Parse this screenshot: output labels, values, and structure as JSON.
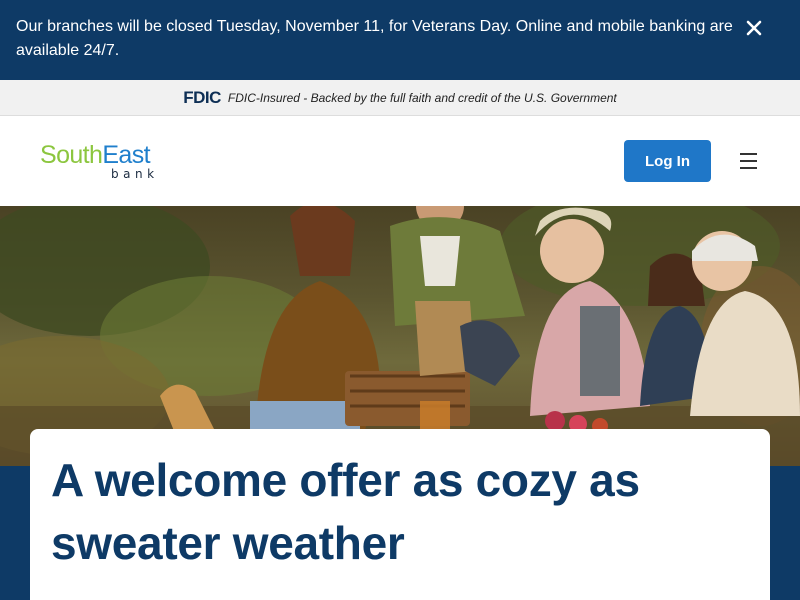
{
  "alert": {
    "message": "Our branches will be closed Tuesday, November 11, for Veterans Day. Online and mobile banking are available 24/7.",
    "close_icon": "close-icon"
  },
  "fdic": {
    "logo_text": "FDIC",
    "statement": "FDIC-Insured - Backed by the full faith and credit of the U.S. Government"
  },
  "header": {
    "logo": {
      "part1": "South",
      "part2": "East",
      "sub": "bank"
    },
    "login_label": "Log In",
    "menu_icon": "hamburger-menu-icon"
  },
  "hero": {
    "image": "family-picnic-photo"
  },
  "offer": {
    "title": "A welcome offer as cozy as sweater weather"
  },
  "colors": {
    "navy": "#0e3a66",
    "login_blue": "#1f77c8",
    "logo_green": "#8cc63f",
    "logo_blue": "#1f7fcc"
  }
}
